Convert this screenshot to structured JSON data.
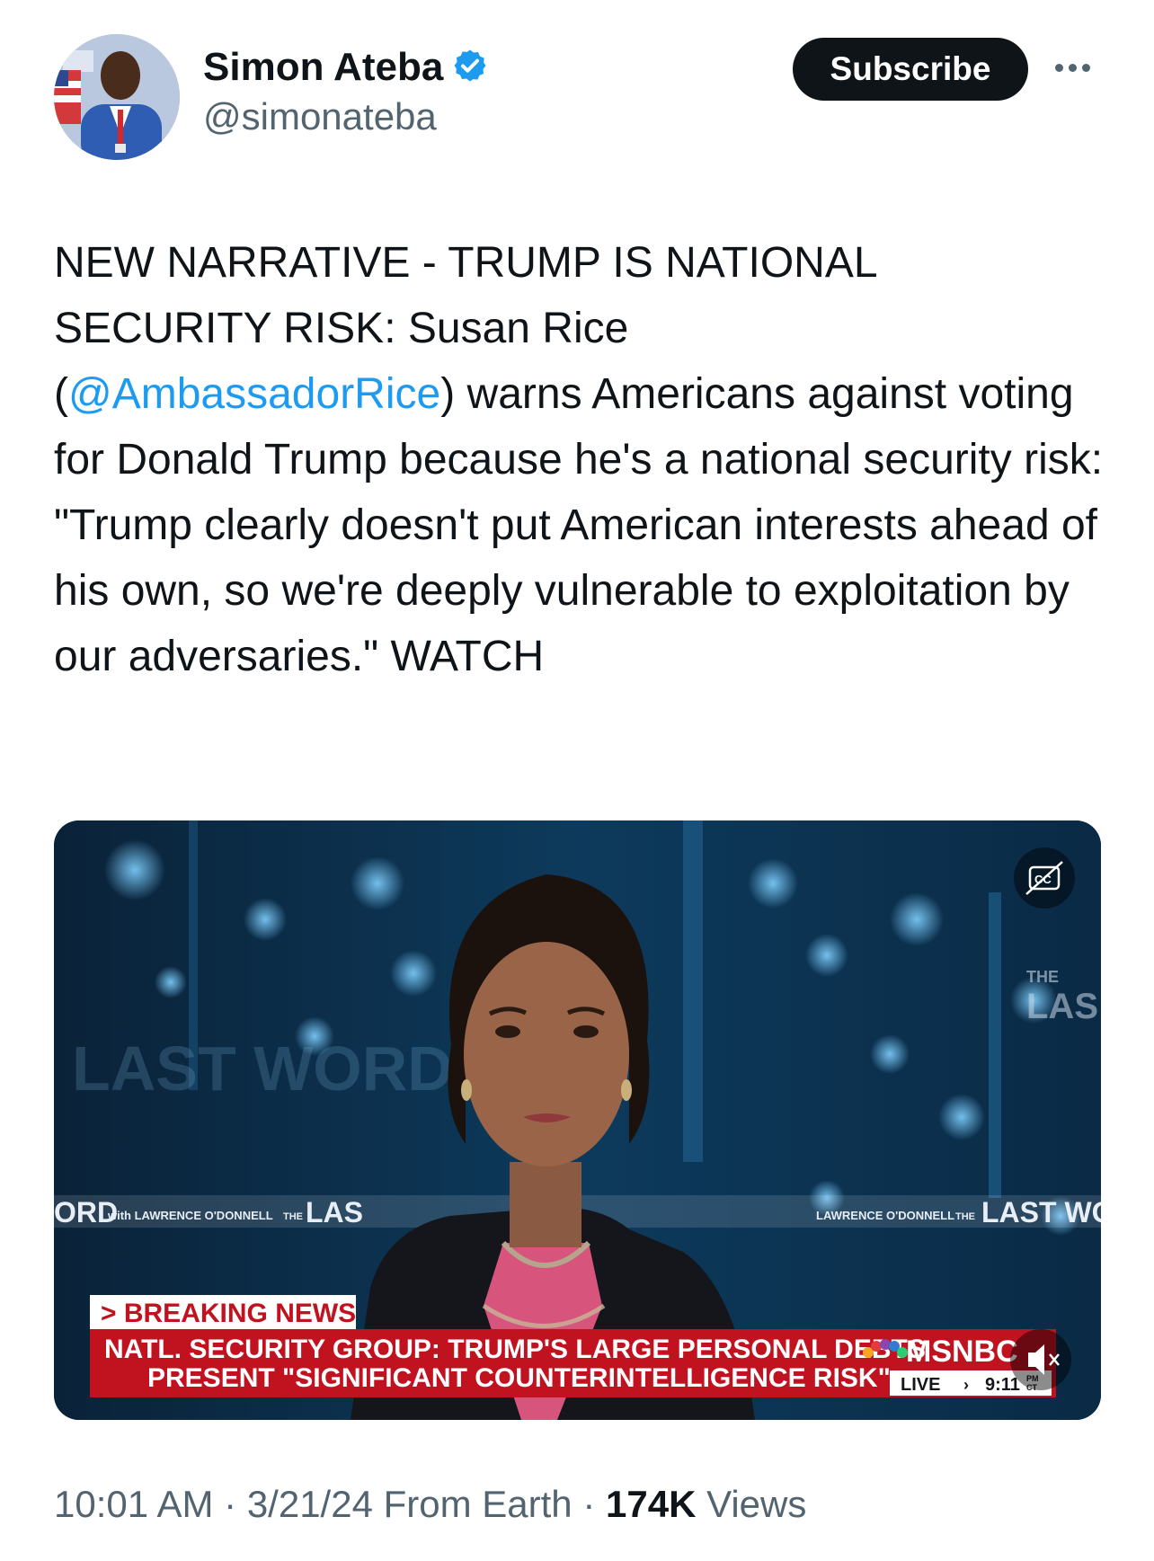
{
  "author": {
    "display_name": "Simon Ateba",
    "handle": "@simonateba",
    "verified_icon": "verified-badge-icon",
    "verified_color": "#1d9bf0"
  },
  "actions": {
    "subscribe_label": "Subscribe",
    "more_icon": "more-horizontal-icon"
  },
  "tweet": {
    "text_before": "NEW NARRATIVE - TRUMP IS NATIONAL\nSECURITY RISK: Susan Rice\n(",
    "mention": "@AmbassadorRice",
    "text_after": ") warns Americans against voting for Donald Trump because he's a national security risk: \"Trump clearly doesn't put American interests ahead of his own, so we're deeply vulnerable to exploitation by our adversaries.\" WATCH",
    "mention_color": "#1d9bf0"
  },
  "video": {
    "breaking_label": "> BREAKING NEWS",
    "headline_line1": "NATL. SECURITY GROUP:  TRUMP'S LARGE PERSONAL DEBTS",
    "headline_line2": "PRESENT \"SIGNIFICANT COUNTERINTELLIGENCE RISK\"",
    "network": "MSNBC",
    "live_label": "LIVE",
    "live_time": "9:11",
    "time_suffix_top": "PM",
    "time_suffix_bottom": "CT",
    "backdrop_left": "ORD",
    "backdrop_left_sub": "with LAWRENCE O'DONNELL",
    "backdrop_the": "THE",
    "backdrop_las": "LAS",
    "backdrop_right_sub": "LAWRENCE O'DONNELL",
    "backdrop_right": "LAST WOR",
    "backdrop_top_the": "THE",
    "backdrop_top_las": "LAS",
    "backdrop_faint": "LAST WORD",
    "cc_icon": "closed-captions-icon",
    "mute_icon": "speaker-muted-icon",
    "accent_red": "#c1121f"
  },
  "meta": {
    "time": "10:01 AM",
    "date": "3/21/24",
    "source": "From Earth",
    "views_count": "174K",
    "views_label": "Views"
  }
}
